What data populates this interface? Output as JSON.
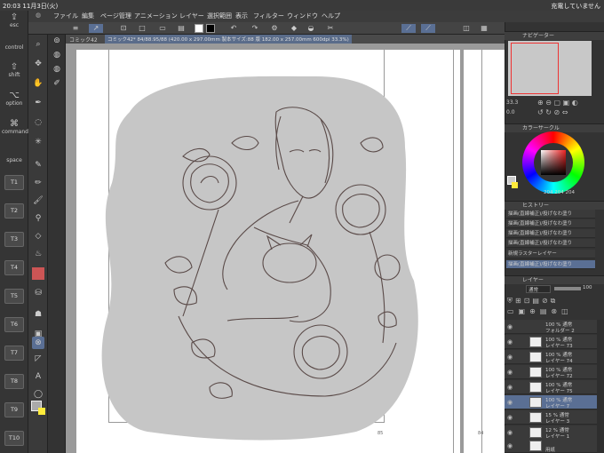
{
  "status": {
    "time": "20:03",
    "date": "11月3日(火)",
    "battery": "充電していません"
  },
  "menu": [
    "ファイル",
    "編集",
    "ページ管理",
    "アニメーション",
    "レイヤー",
    "選択範囲",
    "表示",
    "フィルター",
    "ウィンドウ",
    "ヘルプ"
  ],
  "modifiers": [
    {
      "glyph": "⇪",
      "label": "esc"
    },
    {
      "glyph": "",
      "label": "control"
    },
    {
      "glyph": "⇧",
      "label": "shift"
    },
    {
      "glyph": "⌥",
      "label": "option"
    },
    {
      "glyph": "⌘",
      "label": "command"
    },
    {
      "glyph": "",
      "label": "space"
    }
  ],
  "tkeys": [
    "T1",
    "T2",
    "T3",
    "T4",
    "T5",
    "T6",
    "T7",
    "T8",
    "T9",
    "T10"
  ],
  "doc": {
    "tab": "コミック42",
    "info": "コミック42* 84/88.95/88 (420.00 x 297.00mm 製本サイズ:88 版 182.00 x 257.00mm 600dpi 33.3%)",
    "page_left": "85",
    "page_right": "84"
  },
  "panels": {
    "navigator": "ナビゲーター",
    "zoom": "33.3",
    "angle": "0.0",
    "color": "カラーサークル",
    "color_values": "204 204 204",
    "history": "ヒストリー",
    "layers_title": "レイヤー",
    "blend": "通常",
    "opacity": "100"
  },
  "history": [
    "描画(直線補正)/投げなわ塗り",
    "描画(直線補正)/投げなわ塗り",
    "描画(直線補正)/投げなわ塗り",
    "描画(直線補正)/投げなわ塗り",
    "新規ラスターレイヤー",
    "描画(直線補正)/投げなわ塗り"
  ],
  "layers": [
    {
      "l1": "100 % 通常",
      "l2": "フォルダー 2"
    },
    {
      "l1": "100 % 通常",
      "l2": "レイヤー 73"
    },
    {
      "l1": "100 % 通常",
      "l2": "レイヤー 74"
    },
    {
      "l1": "100 % 通常",
      "l2": "レイヤー 72"
    },
    {
      "l1": "100 % 通常",
      "l2": "レイヤー 75"
    },
    {
      "l1": "100 % 通常",
      "l2": "レイヤー 7"
    },
    {
      "l1": "15 % 通常",
      "l2": "レイヤー 3"
    },
    {
      "l1": "12 % 通常",
      "l2": "レイヤー 1"
    },
    {
      "l1": "",
      "l2": "用紙"
    }
  ],
  "colors": {
    "accent": "#5a6f94",
    "canvas_bg": "#9a9a9a",
    "blob": "#c9c9c9",
    "line": "#5a4a48"
  }
}
